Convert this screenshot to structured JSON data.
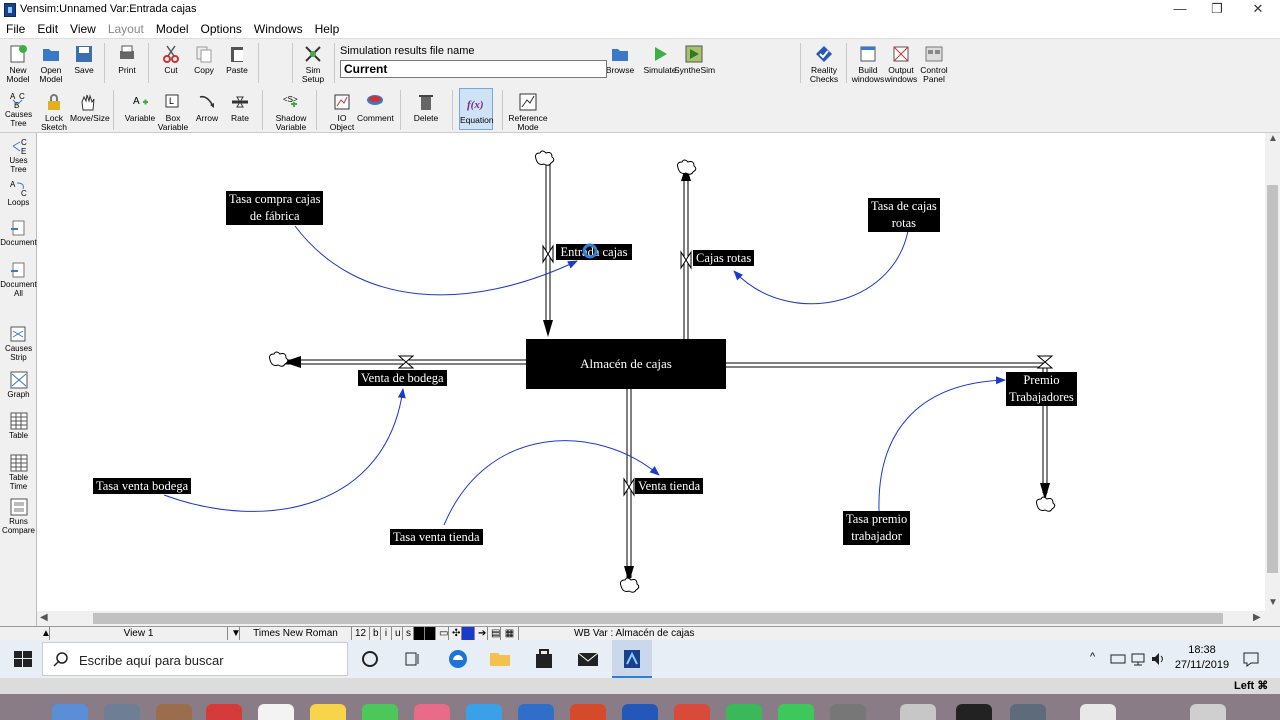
{
  "window": {
    "title": "Vensim:Unnamed Var:Entrada cajas"
  },
  "menu": [
    "File",
    "Edit",
    "View",
    "Layout",
    "Model",
    "Options",
    "Windows",
    "Help"
  ],
  "toolbar": {
    "new_model": "New\nModel",
    "open_model": "Open\nModel",
    "save": "Save",
    "print": "Print",
    "cut": "Cut",
    "copy": "Copy",
    "paste": "Paste",
    "sim_setup": "Sim\nSetup",
    "sim_label": "Simulation results file name",
    "sim_value": "Current",
    "browse": "Browse",
    "simulate": "Simulate",
    "synthesim": "SyntheSim",
    "reality_checks": "Reality\nChecks",
    "build_windows": "Build\nwindows",
    "output_windows": "Output\nwindows",
    "control_panel": "Control\nPanel"
  },
  "sketch_tools": {
    "lock_sketch": "Lock\nSketch",
    "move_size": "Move/Size",
    "variable": "Variable",
    "box_variable": "Box\nVariable",
    "arrow": "Arrow",
    "rate": "Rate",
    "shadow_variable": "Shadow\nVariable",
    "io_object": "IO\nObject",
    "comment": "Comment",
    "delete": "Delete",
    "equation": "Equation",
    "reference_mode": "Reference\nMode"
  },
  "analysis_tools": [
    "Causes\nTree",
    "Uses\nTree",
    "Loops",
    "Document",
    "Document\nAll",
    "Causes\nStrip",
    "Graph",
    "Table",
    "Table\nTime",
    "Runs\nCompare"
  ],
  "diagram": {
    "stock": "Almacén de cajas",
    "entrada": "Entrada cajas",
    "cajas_rotas": "Cajas rotas",
    "venta_bodega": "Venta de bodega",
    "venta_tienda": "Venta tienda",
    "premio": "Premio\nTrabajadores",
    "tasa_compra": "Tasa compra cajas\nde fábrica",
    "tasa_rotas": "Tasa de cajas\nrotas",
    "tasa_venta_bodega": "Tasa venta bodega",
    "tasa_venta_tienda": "Tasa venta tienda",
    "tasa_premio": "Tasa premio\ntrabajador"
  },
  "status": {
    "view": "View 1",
    "font": "Times New Roman",
    "size": "12",
    "b": "b",
    "i": "i",
    "u": "u",
    "s": "s",
    "selection": "WB Var : Almacén de cajas"
  },
  "taskbar": {
    "search_placeholder": "Escribe aquí para buscar",
    "time": "18:38",
    "date": "27/11/2019"
  },
  "tray": {
    "text": "Left ⌘"
  },
  "colors": {
    "flow": "#000000",
    "link": "#1a3acc",
    "label_bg": "#000000",
    "label_fg": "#ffffff"
  }
}
